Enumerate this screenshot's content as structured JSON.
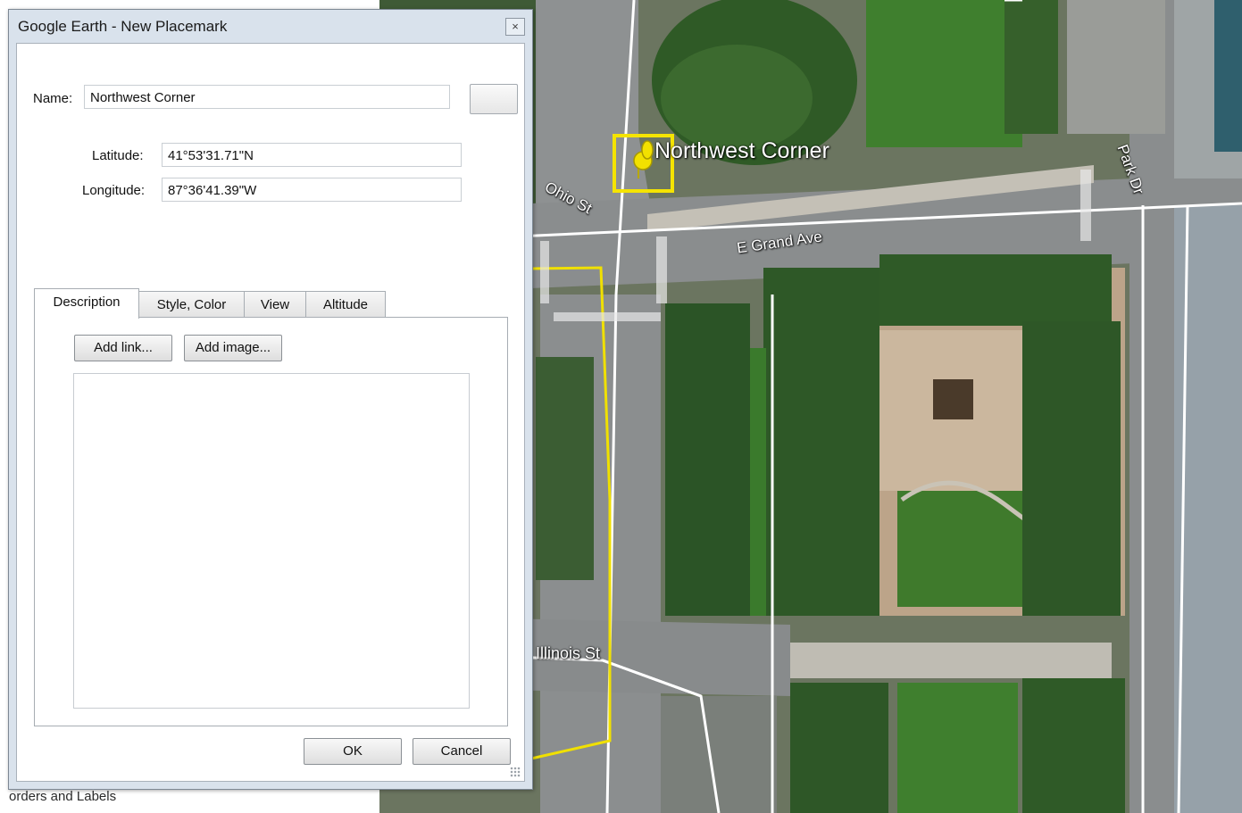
{
  "dialog": {
    "title": "Google Earth - New Placemark",
    "close_glyph": "×",
    "name_label": "Name:",
    "name_value": "Northwest Corner",
    "latitude_label": "Latitude:",
    "latitude_value": "41°53'31.71\"N",
    "longitude_label": "Longitude:",
    "longitude_value": "87°36'41.39\"W",
    "tabs": [
      {
        "label": "Description"
      },
      {
        "label": "Style, Color"
      },
      {
        "label": "View"
      },
      {
        "label": "Altitude"
      }
    ],
    "add_link_label": "Add link...",
    "add_image_label": "Add image...",
    "description_value": "",
    "ok_label": "OK",
    "cancel_label": "Cancel"
  },
  "sidebar": {
    "partial_label": "orders and Labels"
  },
  "map": {
    "placemark_label": "Northwest Corner",
    "street_labels": {
      "ohio": "Ohio St",
      "grand": "E Grand Ave",
      "park": "Park Dr",
      "illinois": "Illinois St"
    },
    "colors": {
      "placemark_highlight": "#f5e400",
      "boundary_line": "#f0e000",
      "road_line": "#ffffff"
    },
    "icons": [
      "pushpin-icon"
    ]
  }
}
